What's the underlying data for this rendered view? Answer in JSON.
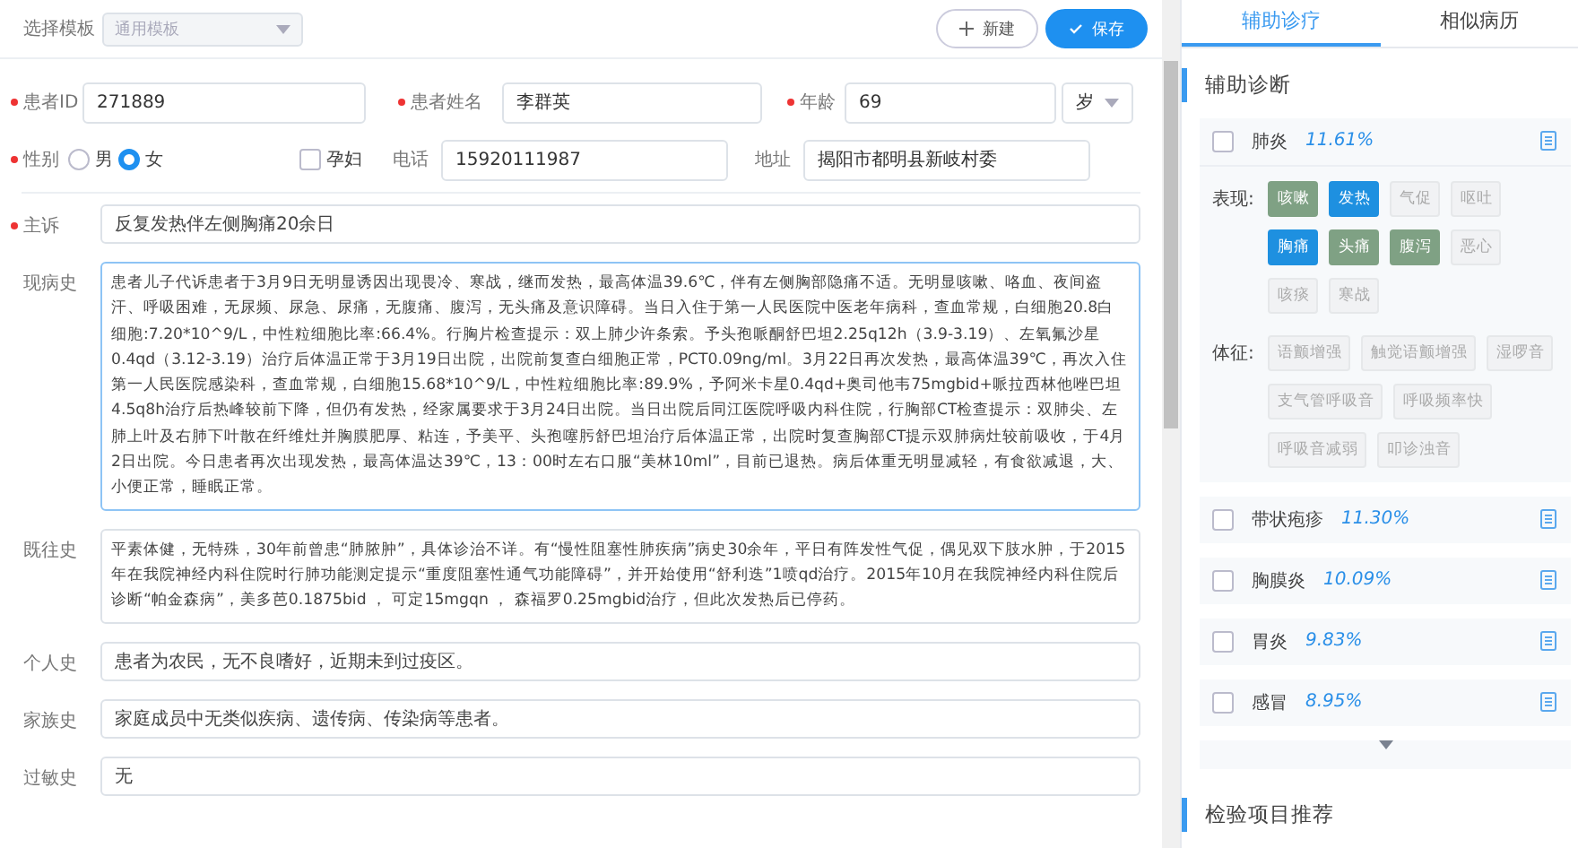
{
  "toolbar": {
    "template_label": "选择模板",
    "template_value": "通用模板",
    "buttons": [
      {
        "kind": "outline",
        "label": "新建"
      },
      {
        "kind": "primary",
        "label": "保存"
      }
    ]
  },
  "patient": {
    "id": {
      "label": "患者ID",
      "required": true,
      "value": "271889"
    },
    "name": {
      "label": "患者姓名",
      "required": true,
      "value": "李群英"
    },
    "age": {
      "label": "年龄",
      "required": true,
      "value": "69",
      "unit": "岁"
    },
    "sex": {
      "label": "性别",
      "required": true,
      "options": [
        {
          "label": "男",
          "selected": false
        },
        {
          "label": "女",
          "selected": true
        }
      ]
    },
    "pregnant": {
      "label": "孕妇",
      "checked": false
    },
    "phone": {
      "label": "电话",
      "required": false,
      "value": "15920111987"
    },
    "address": {
      "label": "地址",
      "required": false,
      "value": "揭阳市都明县新岐村委"
    }
  },
  "record": [
    {
      "label": "主诉",
      "required": true,
      "kind": "line",
      "value": "反复发热伴左侧胸痛20余日"
    },
    {
      "label": "现病史",
      "required": false,
      "kind": "area",
      "focused": true,
      "value": "患者儿子代诉患者于3月9日无明显诱因出现畏冷、寒战，继而发热，最高体温39.6℃，伴有左侧胸部隐痛不适。无明显咳嗽、咯血、夜间盗汗、呼吸困难，无尿频、尿急、尿痛，无腹痛、腹泻，无头痛及意识障碍。当日入住于第一人民医院中医老年病科，查血常规，白细胞20.8白细胞:7.20*10^9/L，中性粒细胞比率:66.4%。行胸片检查提示：双上肺少许条索。予头孢哌酮舒巴坦2.25q12h（3.9-3.19）、左氧氟沙星0.4qd（3.12-3.19）治疗后体温正常于3月19日出院，出院前复查白细胞正常，PCT0.09ng/ml。3月22日再次发热，最高体温39℃，再次入住第一人民医院感染科，查血常规，白细胞15.68*10^9/L，中性粒细胞比率:89.9%，予阿米卡星0.4qd+奥司他韦75mgbid+哌拉西林他唑巴坦4.5q8h治疗后热峰较前下降，但仍有发热，经家属要求于3月24日出院。当日出院后同江医院呼吸内科住院，行胸部CT检查提示：双肺尖、左肺上叶及右肺下叶散在纤维灶并胸膜肥厚、粘连，予美平、头孢噻肟舒巴坦治疗后体温正常，出院时复查胸部CT提示双肺病灶较前吸收，于4月2日出院。今日患者再次出现发热，最高体温达39℃，13：00时左右口服“美林10ml”，目前已退热。病后体重无明显减轻，有食欲减退，大、小便正常，睡眠正常。"
    },
    {
      "label": "既往史",
      "required": false,
      "kind": "area",
      "focused": false,
      "value": "平素体健，无特殊，30年前曾患“肺脓肿”，具体诊治不详。有“慢性阻塞性肺疾病”病史30余年，平日有阵发性气促，偶见双下肢水肿，于2015年在我院神经内科住院时行肺功能测定提示“重度阻塞性通气功能障碍”，并开始使用“舒利迭”1喷qd治疗。2015年10月在我院神经内科住院后诊断“帕金森病”，美多芭0.1875bid ，  可定15mgqn  ，  森福罗0.25mgbid治疗，但此次发热后已停药。"
    },
    {
      "label": "个人史",
      "required": false,
      "kind": "line",
      "value": "患者为农民，无不良嗜好，近期未到过疫区。"
    },
    {
      "label": "家族史",
      "required": false,
      "kind": "line",
      "value": "家庭成员中无类似疾病、遗传病、传染病等患者。"
    },
    {
      "label": "过敏史",
      "required": false,
      "kind": "line",
      "value": "无"
    }
  ],
  "side_tabs": [
    {
      "label": "辅助诊疗",
      "selected": true
    },
    {
      "label": "相似病历",
      "selected": false
    }
  ],
  "diagnosis_heading": "辅助诊断",
  "diagnoses": [
    {
      "name": "肺炎",
      "probability": "11.61%",
      "checked": false,
      "expanded": true,
      "groups": [
        {
          "label": "表现:",
          "tags": [
            {
              "text": "咳嗽",
              "kind": "present"
            },
            {
              "text": "发热",
              "kind": "confirmed"
            },
            {
              "text": "气促",
              "kind": "none"
            },
            {
              "text": "呕吐",
              "kind": "none"
            },
            {
              "text": "胸痛",
              "kind": "confirmed"
            },
            {
              "text": "头痛",
              "kind": "present"
            },
            {
              "text": "腹泻",
              "kind": "present"
            },
            {
              "text": "恶心",
              "kind": "none"
            },
            {
              "text": "咳痰",
              "kind": "none"
            },
            {
              "text": "寒战",
              "kind": "none"
            }
          ]
        },
        {
          "label": "体征:",
          "tags": [
            {
              "text": "语颤增强",
              "kind": "none"
            },
            {
              "text": "触觉语颤增强",
              "kind": "none"
            },
            {
              "text": "湿啰音",
              "kind": "none"
            },
            {
              "text": "支气管呼吸音",
              "kind": "none"
            },
            {
              "text": "呼吸频率快",
              "kind": "none"
            },
            {
              "text": "呼吸音减弱",
              "kind": "none"
            },
            {
              "text": "叩诊浊音",
              "kind": "none"
            }
          ]
        }
      ]
    },
    {
      "name": "带状疱疹",
      "probability": "11.30%",
      "checked": false,
      "expanded": false
    },
    {
      "name": "胸膜炎",
      "probability": "10.09%",
      "checked": false,
      "expanded": false
    },
    {
      "name": "胃炎",
      "probability": "9.83%",
      "checked": false,
      "expanded": false
    },
    {
      "name": "感冒",
      "probability": "8.95%",
      "checked": false,
      "expanded": false
    }
  ],
  "tests_heading": "检验项目推荐"
}
